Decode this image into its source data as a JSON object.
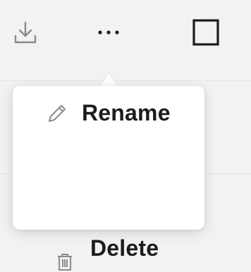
{
  "toolbar": {
    "download_icon": "download-icon",
    "more_icon": "more-horizontal-icon",
    "square_icon": "square-icon"
  },
  "menu": {
    "items": [
      {
        "label": "Rename",
        "icon": "pencil-icon"
      },
      {
        "label": "Delete",
        "icon": "trash-icon"
      }
    ]
  },
  "colors": {
    "background": "#f2f2f2",
    "menu_bg": "#ffffff",
    "text": "#1c1c1c",
    "icon_muted": "#8a8a8a"
  }
}
